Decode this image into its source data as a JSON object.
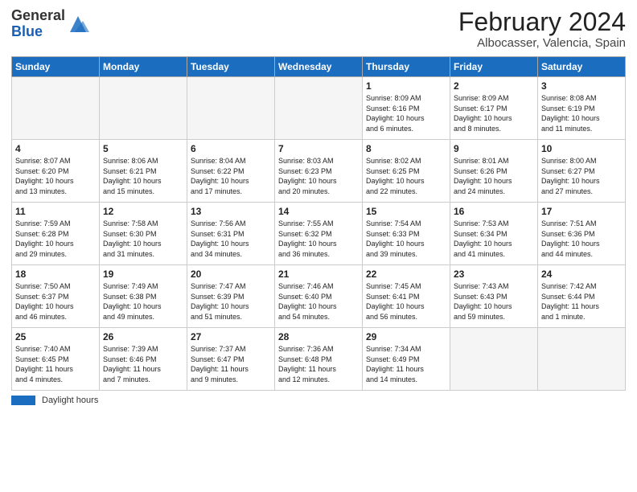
{
  "logo": {
    "general": "General",
    "blue": "Blue"
  },
  "title": "February 2024",
  "subtitle": "Albocasser, Valencia, Spain",
  "days_of_week": [
    "Sunday",
    "Monday",
    "Tuesday",
    "Wednesday",
    "Thursday",
    "Friday",
    "Saturday"
  ],
  "footer": {
    "legend_label": "Daylight hours"
  },
  "weeks": [
    [
      {
        "day": "",
        "detail": ""
      },
      {
        "day": "",
        "detail": ""
      },
      {
        "day": "",
        "detail": ""
      },
      {
        "day": "",
        "detail": ""
      },
      {
        "day": "1",
        "detail": "Sunrise: 8:09 AM\nSunset: 6:16 PM\nDaylight: 10 hours\nand 6 minutes."
      },
      {
        "day": "2",
        "detail": "Sunrise: 8:09 AM\nSunset: 6:17 PM\nDaylight: 10 hours\nand 8 minutes."
      },
      {
        "day": "3",
        "detail": "Sunrise: 8:08 AM\nSunset: 6:19 PM\nDaylight: 10 hours\nand 11 minutes."
      }
    ],
    [
      {
        "day": "4",
        "detail": "Sunrise: 8:07 AM\nSunset: 6:20 PM\nDaylight: 10 hours\nand 13 minutes."
      },
      {
        "day": "5",
        "detail": "Sunrise: 8:06 AM\nSunset: 6:21 PM\nDaylight: 10 hours\nand 15 minutes."
      },
      {
        "day": "6",
        "detail": "Sunrise: 8:04 AM\nSunset: 6:22 PM\nDaylight: 10 hours\nand 17 minutes."
      },
      {
        "day": "7",
        "detail": "Sunrise: 8:03 AM\nSunset: 6:23 PM\nDaylight: 10 hours\nand 20 minutes."
      },
      {
        "day": "8",
        "detail": "Sunrise: 8:02 AM\nSunset: 6:25 PM\nDaylight: 10 hours\nand 22 minutes."
      },
      {
        "day": "9",
        "detail": "Sunrise: 8:01 AM\nSunset: 6:26 PM\nDaylight: 10 hours\nand 24 minutes."
      },
      {
        "day": "10",
        "detail": "Sunrise: 8:00 AM\nSunset: 6:27 PM\nDaylight: 10 hours\nand 27 minutes."
      }
    ],
    [
      {
        "day": "11",
        "detail": "Sunrise: 7:59 AM\nSunset: 6:28 PM\nDaylight: 10 hours\nand 29 minutes."
      },
      {
        "day": "12",
        "detail": "Sunrise: 7:58 AM\nSunset: 6:30 PM\nDaylight: 10 hours\nand 31 minutes."
      },
      {
        "day": "13",
        "detail": "Sunrise: 7:56 AM\nSunset: 6:31 PM\nDaylight: 10 hours\nand 34 minutes."
      },
      {
        "day": "14",
        "detail": "Sunrise: 7:55 AM\nSunset: 6:32 PM\nDaylight: 10 hours\nand 36 minutes."
      },
      {
        "day": "15",
        "detail": "Sunrise: 7:54 AM\nSunset: 6:33 PM\nDaylight: 10 hours\nand 39 minutes."
      },
      {
        "day": "16",
        "detail": "Sunrise: 7:53 AM\nSunset: 6:34 PM\nDaylight: 10 hours\nand 41 minutes."
      },
      {
        "day": "17",
        "detail": "Sunrise: 7:51 AM\nSunset: 6:36 PM\nDaylight: 10 hours\nand 44 minutes."
      }
    ],
    [
      {
        "day": "18",
        "detail": "Sunrise: 7:50 AM\nSunset: 6:37 PM\nDaylight: 10 hours\nand 46 minutes."
      },
      {
        "day": "19",
        "detail": "Sunrise: 7:49 AM\nSunset: 6:38 PM\nDaylight: 10 hours\nand 49 minutes."
      },
      {
        "day": "20",
        "detail": "Sunrise: 7:47 AM\nSunset: 6:39 PM\nDaylight: 10 hours\nand 51 minutes."
      },
      {
        "day": "21",
        "detail": "Sunrise: 7:46 AM\nSunset: 6:40 PM\nDaylight: 10 hours\nand 54 minutes."
      },
      {
        "day": "22",
        "detail": "Sunrise: 7:45 AM\nSunset: 6:41 PM\nDaylight: 10 hours\nand 56 minutes."
      },
      {
        "day": "23",
        "detail": "Sunrise: 7:43 AM\nSunset: 6:43 PM\nDaylight: 10 hours\nand 59 minutes."
      },
      {
        "day": "24",
        "detail": "Sunrise: 7:42 AM\nSunset: 6:44 PM\nDaylight: 11 hours\nand 1 minute."
      }
    ],
    [
      {
        "day": "25",
        "detail": "Sunrise: 7:40 AM\nSunset: 6:45 PM\nDaylight: 11 hours\nand 4 minutes."
      },
      {
        "day": "26",
        "detail": "Sunrise: 7:39 AM\nSunset: 6:46 PM\nDaylight: 11 hours\nand 7 minutes."
      },
      {
        "day": "27",
        "detail": "Sunrise: 7:37 AM\nSunset: 6:47 PM\nDaylight: 11 hours\nand 9 minutes."
      },
      {
        "day": "28",
        "detail": "Sunrise: 7:36 AM\nSunset: 6:48 PM\nDaylight: 11 hours\nand 12 minutes."
      },
      {
        "day": "29",
        "detail": "Sunrise: 7:34 AM\nSunset: 6:49 PM\nDaylight: 11 hours\nand 14 minutes."
      },
      {
        "day": "",
        "detail": ""
      },
      {
        "day": "",
        "detail": ""
      }
    ]
  ]
}
